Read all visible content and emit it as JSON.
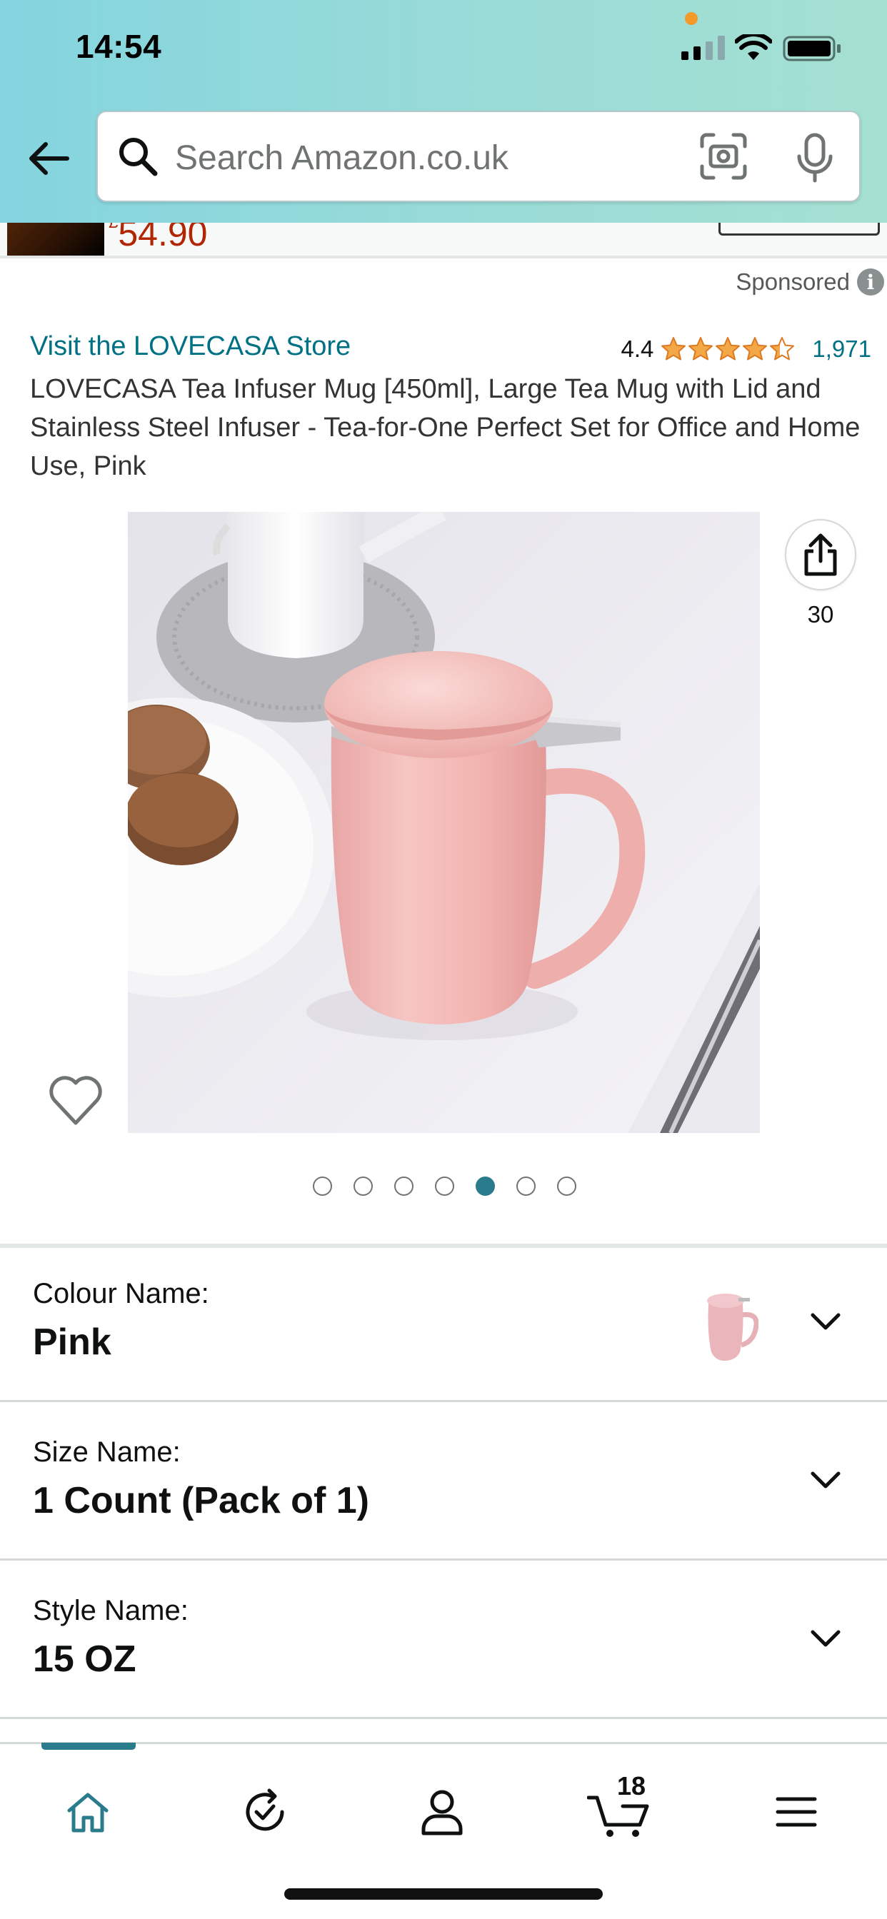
{
  "status_bar": {
    "time": "14:54"
  },
  "search": {
    "placeholder": "Search Amazon.co.uk"
  },
  "previous_item": {
    "currency": "£",
    "price": "54.90"
  },
  "sponsored_label": "Sponsored",
  "product": {
    "store_link": "Visit the LOVECASA Store",
    "rating_value": "4.4",
    "rating_count": "1,971",
    "title": "LOVECASA Tea Infuser Mug [450ml], Large Tea Mug with Lid and Stainless Steel Infuser - Tea-for-One Perfect Set for Office and Home Use, Pink",
    "share_count": "30",
    "image_count": 7,
    "active_image_index": 5,
    "star_fill_fraction": 0.88
  },
  "variations": [
    {
      "label": "Colour Name:",
      "value": "Pink"
    },
    {
      "label": "Size Name:",
      "value": "1 Count (Pack of 1)"
    },
    {
      "label": "Style Name:",
      "value": "15 OZ"
    }
  ],
  "tabbar": {
    "items": [
      "home-icon",
      "refresh-check-icon",
      "account-icon",
      "cart-icon",
      "menu-icon"
    ],
    "cart_count": "18"
  },
  "colors": {
    "link": "#007185",
    "star": "#f3a847",
    "price": "#b12704",
    "accent": "#2a7c8c"
  }
}
